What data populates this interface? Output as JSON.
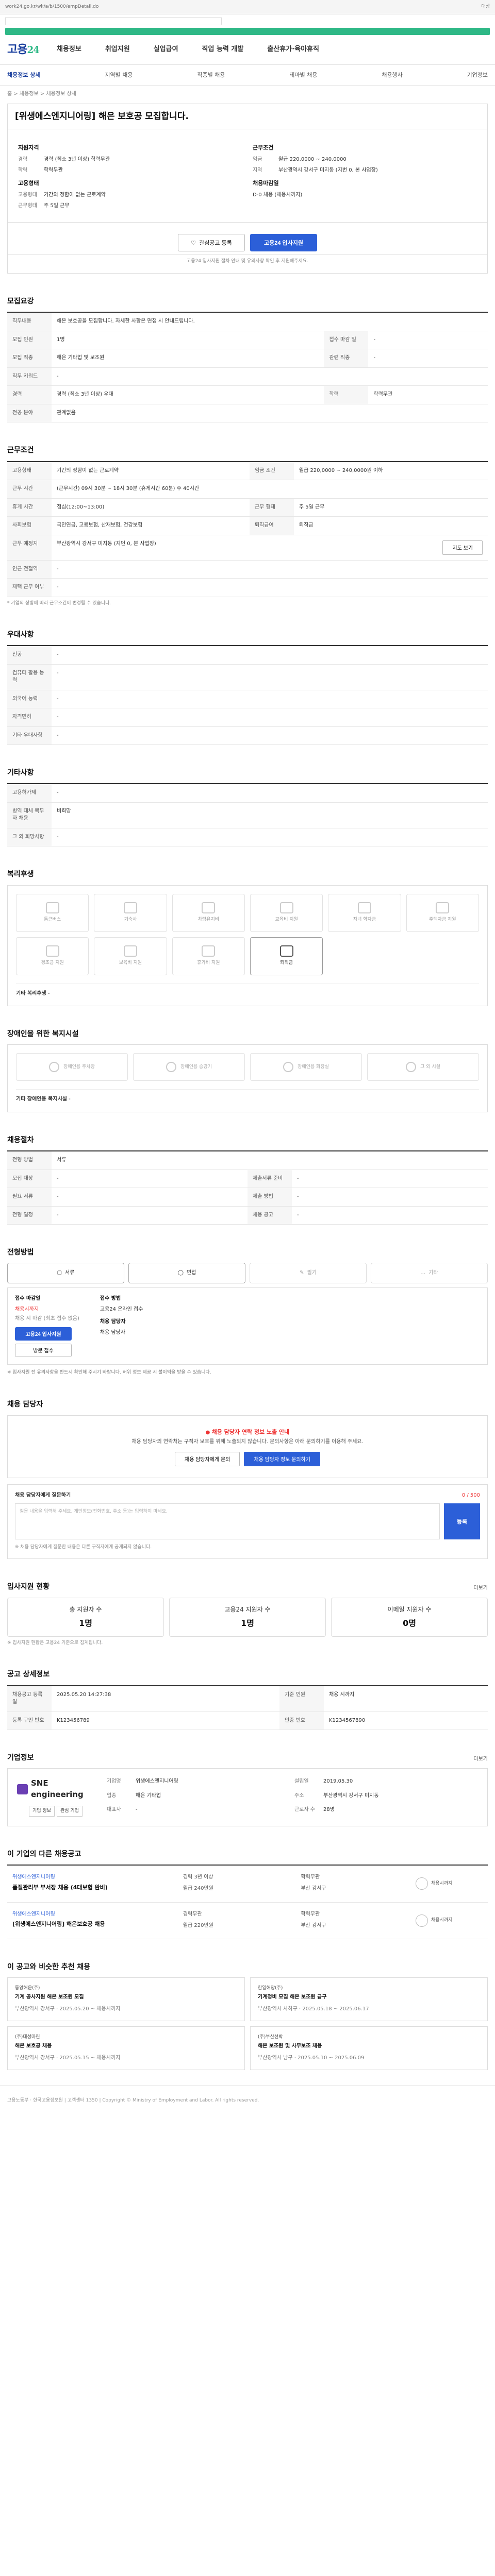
{
  "browser": {
    "url": "work24.go.kr/wk/a/b/1500/empDetail.do",
    "status": "대상"
  },
  "logo": {
    "main": "고용",
    "accent": "24"
  },
  "gnb": [
    "채용정보",
    "취업지원",
    "실업급여",
    "직업 능력 개발",
    "출산휴가·육아휴직"
  ],
  "lnb": {
    "items": [
      "채용정보 상세",
      "지역별 채용",
      "직종별 채용",
      "테마별 채용",
      "채용행사",
      "기업정보"
    ],
    "active": 0
  },
  "breadcrumb": "홈 > 채용정보 > 채용정보 상세",
  "job": {
    "title": "[위생에스엔지니어링] 해은 보호공 모집합니다."
  },
  "overview": {
    "req_title": "지원자격",
    "career_k": "경력",
    "career_v": "경력 (최소 3년 이상) 학력무관",
    "edu_k": "학력",
    "edu_v": "학력무관",
    "cond_title": "근무조건",
    "pay_k": "임금",
    "pay_v": "월급 220,0000 ~ 240,0000",
    "loc_k": "지역",
    "loc_v": "부산광역시 강서구 미지동 (지번 0, 본 사업장)",
    "type_title": "고용형태",
    "type_k": "고용형태",
    "type_v": "기간의 정함이 없는 근로계약",
    "work_k": "근무형태",
    "work_v": "주 5일 근무",
    "dl_title": "채용마감일",
    "dl_v": "D-0 채용 (채용시까지)"
  },
  "actions": {
    "interest": "관심공고 등록",
    "apply": "고용24 입사지원",
    "note": "고용24 입사지원 절차 안내 및 유의사항 확인 후 지원해주세요."
  },
  "recruit": {
    "title": "모집요강",
    "duty_k": "직무내용",
    "duty_v": "해은 보호공을 모집합니다. 자세한 사항은 면접 시 안내드립니다.",
    "rows": [
      {
        "k": "모집 인원",
        "v": "1명",
        "k2": "접수 마감 일",
        "v2": "-"
      },
      {
        "k": "모집 직종",
        "v": "해은 기타업 및 보조원",
        "k2": "관련 직종",
        "v2": "-"
      },
      {
        "k": "직무 키워드",
        "v": "-",
        "k2": "",
        "v2": ""
      },
      {
        "k": "경력",
        "v": "경력 (최소 3년 이상) 우대",
        "k2": "학력",
        "v2": "학력무관"
      },
      {
        "k": "전공 분야",
        "v": "관계없음",
        "k2": "",
        "v2": ""
      }
    ]
  },
  "worksite": {
    "title": "근무조건",
    "rows": [
      {
        "k": "고용형태",
        "v": "기간의 정함이 없는 근로계약",
        "k2": "임금 조건",
        "v2": "월급 220,0000 ~ 240,0000원 이하"
      },
      {
        "k": "근무 시간",
        "v": "(근무시간) 09시 30분 ~ 18시 30분 (휴게시간 60분) 주 40시간",
        "k2": "",
        "v2": ""
      },
      {
        "k": "휴게 시간",
        "v": "점심(12:00~13:00)",
        "k2": "근무 형태",
        "v2": "주 5일 근무"
      },
      {
        "k": "사회보험",
        "v": "국민연금, 고용보험, 산재보험, 건강보험",
        "k2": "퇴직급여",
        "v2": "퇴직금"
      },
      {
        "k": "근무 예정지",
        "v": "부산광역시 강서구 미지동 (지번 0, 본 사업장)",
        "k2": "",
        "v2": "지도 보기"
      },
      {
        "k": "인근 전철역",
        "v": "-",
        "k2": "",
        "v2": ""
      },
      {
        "k": "재택 근무 여부",
        "v": "-",
        "k2": "",
        "v2": ""
      }
    ],
    "note": "* 기업의 상황에 따라 근무조건이 변경될 수 있습니다."
  },
  "preference": {
    "title": "우대사항",
    "rows": [
      {
        "k": "전공",
        "v": "-"
      },
      {
        "k": "컴퓨터 활용 능력",
        "v": "-"
      },
      {
        "k": "외국어 능력",
        "v": "-"
      },
      {
        "k": "자격면허",
        "v": "-"
      },
      {
        "k": "기타 우대사항",
        "v": "-"
      }
    ]
  },
  "etc": {
    "title": "기타사항",
    "rows": [
      {
        "k": "고용허가제",
        "v": "-"
      },
      {
        "k": "병역 대체 복무자 채용",
        "v": "비희망"
      },
      {
        "k": "그 외 희망사항",
        "v": "-"
      }
    ]
  },
  "welfare": {
    "title": "복리후생",
    "items": [
      {
        "label": "통근버스",
        "on": false
      },
      {
        "label": "기숙사",
        "on": false
      },
      {
        "label": "차량유지비",
        "on": false
      },
      {
        "label": "교육비 지원",
        "on": false
      },
      {
        "label": "자녀 학자금",
        "on": false
      },
      {
        "label": "주택자금 지원",
        "on": false
      },
      {
        "label": "경조금 지원",
        "on": false
      },
      {
        "label": "보육비 지원",
        "on": false
      },
      {
        "label": "휴가비 지원",
        "on": false
      },
      {
        "label": "퇴직금",
        "on": true
      }
    ],
    "bottom_k": "기타 복리후생",
    "bottom_v": "-"
  },
  "disability": {
    "title": "장애인을 위한 복지시설",
    "items": [
      "장애인용 주차장",
      "장애인용 승강기",
      "장애인용 화장실",
      "그 외 시설"
    ],
    "bottom_k": "기타 장애인용 복지시설",
    "bottom_v": "-"
  },
  "process": {
    "title": "채용절차",
    "rows": [
      {
        "k": "전형 방법",
        "v": "서류",
        "k2": "",
        "v2": ""
      },
      {
        "k": "모집 대상",
        "v": "-",
        "k2": "제출서류 준비",
        "v2": "-"
      },
      {
        "k": "필요 서류",
        "v": "-",
        "k2": "제출 방법",
        "v2": "-"
      },
      {
        "k": "전형 일정",
        "v": "-",
        "k2": "채용 공고",
        "v2": "-"
      }
    ]
  },
  "apply": {
    "title": "전형방법",
    "methods": [
      {
        "label": "서류",
        "on": true
      },
      {
        "label": "면접",
        "on": true
      },
      {
        "label": "필기",
        "on": false
      },
      {
        "label": "기타",
        "on": false
      }
    ],
    "deadline_lbl": "접수 마감일",
    "deadline_v": "채용시까지",
    "deadline_sub": "채용 시 마감 (최초 접수 없음)",
    "apply_btn": "고용24 입사지원",
    "apply_btn2": "방문 접수",
    "contact_lbl": "접수 방법",
    "contact_v": "고용24 온라인 접수",
    "manager_lbl": "채용 담당자",
    "manager_v": "채용 담당자",
    "notice": "※ 입사지원 전 유의사항을 반드시 확인해 주시기 바랍니다. 허위 정보 제공 시 불이익을 받을 수 있습니다."
  },
  "inquiry": {
    "title": "채용 담당자",
    "warn": "채용 담당자 연락 정보 노출 안내",
    "text": "채용 담당자의 연락처는 구직자 보호를 위해 노출되지 않습니다. 문의사항은 아래 문의하기를 이용해 주세요.",
    "btn1": "채용 담당자에게 문의",
    "btn2": "채용 담당자 정보 문의하기",
    "qa_title": "채용 담당자에게 질문하기",
    "qa_count": "0 / 500",
    "qa_placeholder": "질문 내용을 입력해 주세요. 개인정보(전화번호, 주소 등)는 입력하지 마세요.",
    "qa_btn": "등록",
    "qa_note": "※ 채용 담당자에게 질문한 내용은 다른 구직자에게 공개되지 않습니다."
  },
  "stats": {
    "title": "입사지원 현황",
    "more": "더보기",
    "items": [
      {
        "k": "총 지원자 수",
        "v": "1명"
      },
      {
        "k": "고용24 지원자 수",
        "v": "1명"
      },
      {
        "k": "이메일 지원자 수",
        "v": "0명"
      }
    ],
    "note": "※ 입사지원 현황은 고용24 기준으로 집계됩니다."
  },
  "meta": {
    "title": "공고 상세정보",
    "rows": [
      {
        "k": "채용공고 등록일",
        "v": "2025.05.20 14:27:38",
        "k2": "기준 인원",
        "v2": "채용 시까지"
      },
      {
        "k": "등록 구인 번호",
        "v": "K123456789",
        "k2": "인증 번호",
        "v2": "K1234567890"
      }
    ]
  },
  "company": {
    "title": "기업정보",
    "more": "더보기",
    "name": "SNE engineering",
    "btn_a": "기업 정보",
    "btn_b": "관심 기업",
    "rows": [
      {
        "k": "기업명",
        "v": "위생에스엔지니어링"
      },
      {
        "k": "업종",
        "v": "해은 기타업"
      },
      {
        "k": "대표자",
        "v": "-"
      },
      {
        "k": "설립일",
        "v": "2019.05.30"
      },
      {
        "k": "주소",
        "v": "부산광역시 강서구 미지동"
      },
      {
        "k": "근로자 수",
        "v": "28명"
      }
    ]
  },
  "similar": {
    "title": "이 기업의 다른 채용공고",
    "jobs": [
      {
        "co": "위생에스엔지니어링",
        "title": "품질관리부 부서장 채용 (4대보험 완비)",
        "info": [
          "경력 3년 이상",
          "학력무관",
          "월급 240만원",
          "부산 강서구"
        ],
        "dl": "채용시까지"
      },
      {
        "co": "위생에스엔지니어링",
        "title": "[위생에스엔지니어링] 해은보호공 채용",
        "info": [
          "경력무관",
          "학력무관",
          "월급 220만원",
          "부산 강서구"
        ],
        "dl": "채용시까지"
      }
    ]
  },
  "recommend": {
    "title": "이 공고와 비슷한 추천 채용",
    "items": [
      {
        "co": "동양해운(주)",
        "title": "기계 공사지원 해은 보조원 모집",
        "meta": "부산광역시 강서구 · 2025.05.20 ~ 채용시까지"
      },
      {
        "co": "한일해양(주)",
        "title": "기계정비 모집 해은 보조원 급구",
        "meta": "부산광역시 사하구 · 2025.05.18 ~ 2025.06.17"
      },
      {
        "co": "(주)대성마린",
        "title": "해은 보호공 채용",
        "meta": "부산광역시 강서구 · 2025.05.15 ~ 채용시까지"
      },
      {
        "co": "(주)부산선박",
        "title": "해은 보조원 및 사무보조 채용",
        "meta": "부산광역시 남구 · 2025.05.10 ~ 2025.06.09"
      }
    ]
  },
  "footer": "고용노동부 · 한국고용정보원 | 고객센터 1350 | Copyright © Ministry of Employment and Labor. All rights reserved."
}
